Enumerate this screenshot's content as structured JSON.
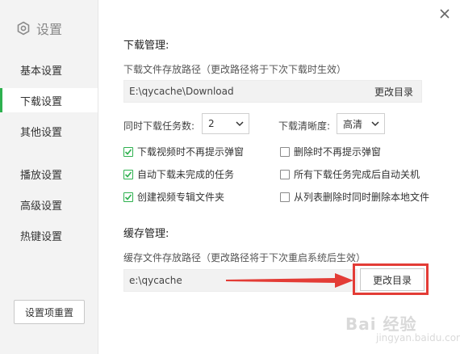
{
  "sidebar": {
    "title": "设置",
    "items": [
      {
        "label": "基本设置"
      },
      {
        "label": "下载设置"
      },
      {
        "label": "其他设置"
      },
      {
        "label": "播放设置"
      },
      {
        "label": "高级设置"
      },
      {
        "label": "热键设置"
      }
    ],
    "active_index": 1,
    "reset_label": "设置项重置"
  },
  "download": {
    "section_title": "下载管理:",
    "path_hint": "下载文件存放路径（更改路径将于下次下载时生效）",
    "path_value": "E:\\qycache\\Download",
    "change_dir_label": "更改目录",
    "concurrent_label": "同时下载任务数:",
    "concurrent_value": "2",
    "quality_label": "下载清晰度:",
    "quality_value": "高清",
    "options": [
      {
        "label": "下载视频时不再提示弹窗",
        "checked": true
      },
      {
        "label": "删除时不再提示弹窗",
        "checked": false
      },
      {
        "label": "自动下载未完成的任务",
        "checked": true
      },
      {
        "label": "所有下载任务完成后自动关机",
        "checked": false
      },
      {
        "label": "创建视频专辑文件夹",
        "checked": true
      },
      {
        "label": "从列表删除时同时删除本地文件",
        "checked": false
      }
    ]
  },
  "cache": {
    "section_title": "缓存管理:",
    "path_hint": "缓存文件存放路径（更改路径将于下次重启系统后生效）",
    "path_value": "e:\\qycache",
    "change_dir_label": "更改目录"
  },
  "watermark": {
    "text": "Bai 经验",
    "sub": "jingyan.baidu.com"
  },
  "colors": {
    "accent": "#2eb14f",
    "annotation": "#e33c36"
  }
}
